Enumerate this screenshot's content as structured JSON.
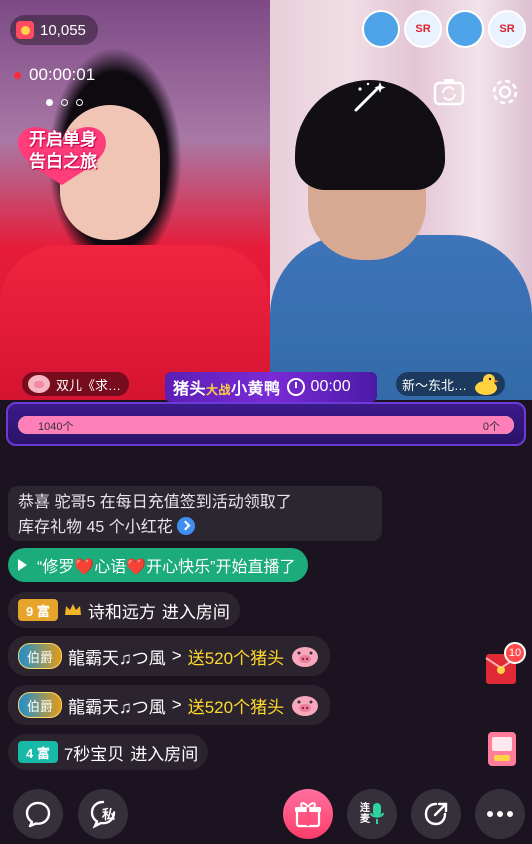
{
  "header": {
    "viewer_count": "10,055",
    "live_timer": "00:00:01",
    "carousel_dots": 3,
    "carousel_active": 1,
    "badge_text_line1": "开启单身",
    "badge_text_line2": "告白之旅"
  },
  "top_avatars": [
    {
      "kind": "blue",
      "label": ""
    },
    {
      "kind": "red",
      "label": "SR"
    },
    {
      "kind": "blue",
      "label": ""
    },
    {
      "kind": "red",
      "label": "SR"
    }
  ],
  "streams": {
    "left_name": "双儿《求…",
    "right_name": "新～东北…"
  },
  "pk": {
    "title_a": "猪头",
    "title_vs": "大战",
    "title_b": "小黄鸭",
    "time": "00:00",
    "score_left": "1040个",
    "score_right": "0个",
    "left_progress": 1.0
  },
  "chat": {
    "notice_line1": "恭喜 驼哥5 在每日充值签到活动领取了",
    "notice_line2": "库存礼物 45 个小红花",
    "live_start": "“修罗❤️心语❤️开心快乐”开始直播了",
    "messages": [
      {
        "badge": "9 富",
        "badge_type": "gold",
        "user": "诗和远方",
        "text": "进入房间"
      },
      {
        "badge": "伯爵",
        "badge_type": "noble",
        "user": "龍霸天♫つ風",
        "arrow": ">",
        "gift": "送520个猪头"
      },
      {
        "badge": "伯爵",
        "badge_type": "noble",
        "user": "龍霸天♫つ風",
        "arrow": ">",
        "gift": "送520个猪头"
      },
      {
        "badge": "4 富",
        "badge_type": "teal",
        "user": "7秒宝贝",
        "text": "进入房间"
      }
    ]
  },
  "side": {
    "envelope_count": "10"
  },
  "bottom": {
    "private_label": "私",
    "lianmai_line1": "连",
    "lianmai_line2": "麦",
    "icons": [
      "chat-bubble-icon",
      "private-chat-icon",
      "gift-icon",
      "lianmai-mic-icon",
      "share-icon",
      "more-icon"
    ]
  },
  "colors": {
    "background": "#1b1420",
    "live_start_green": "#1cab7b",
    "gift_yellow": "#ffd92a",
    "pk_purple": "#5b1fb5",
    "progress_pink": "#ff7fb8"
  }
}
